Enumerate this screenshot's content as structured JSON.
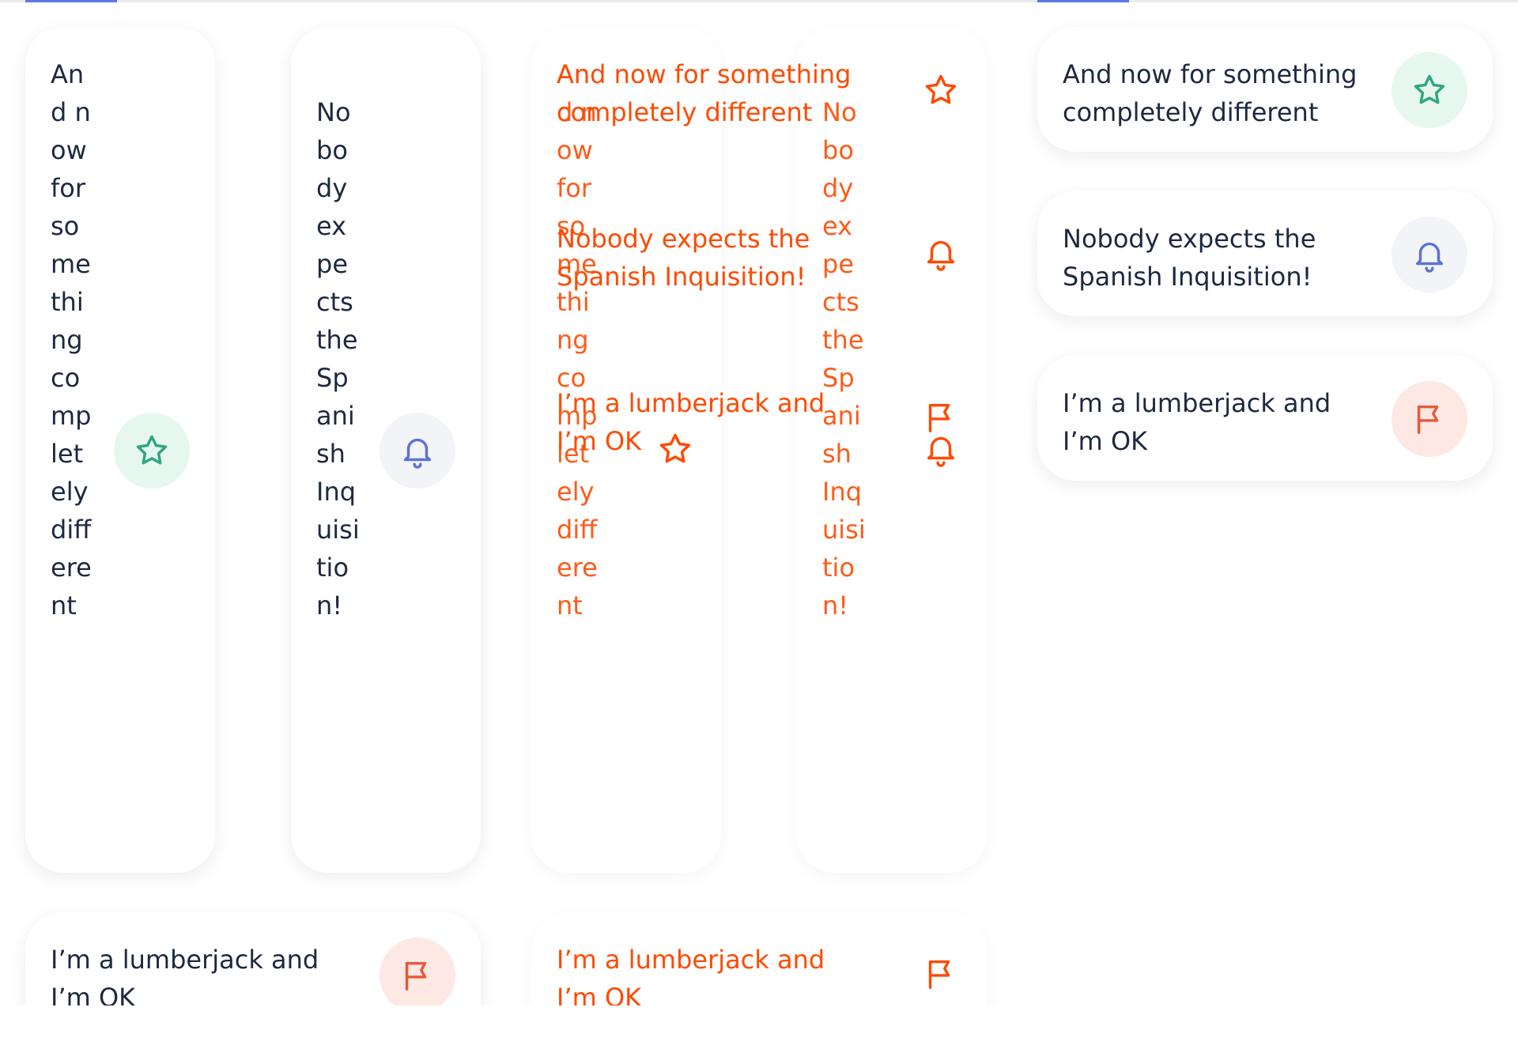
{
  "messages": [
    {
      "text": "And now for something completely different",
      "icon": "star-icon",
      "color": "#2fa77a",
      "bg": "#e6f7f0"
    },
    {
      "text": "Nobody expects the Spanish Inquisition!",
      "icon": "bell-icon",
      "color": "#5b72d6",
      "bg": "#f3f4f8"
    },
    {
      "text": "I’m a lumberjack and I’m OK",
      "icon": "flag-icon",
      "color": "#e8583a",
      "bg": "#fde8e3"
    }
  ],
  "overlay_color": "#ff4a00",
  "panels": [
    "broken-layout",
    "debug-overlay",
    "correct-layout"
  ]
}
